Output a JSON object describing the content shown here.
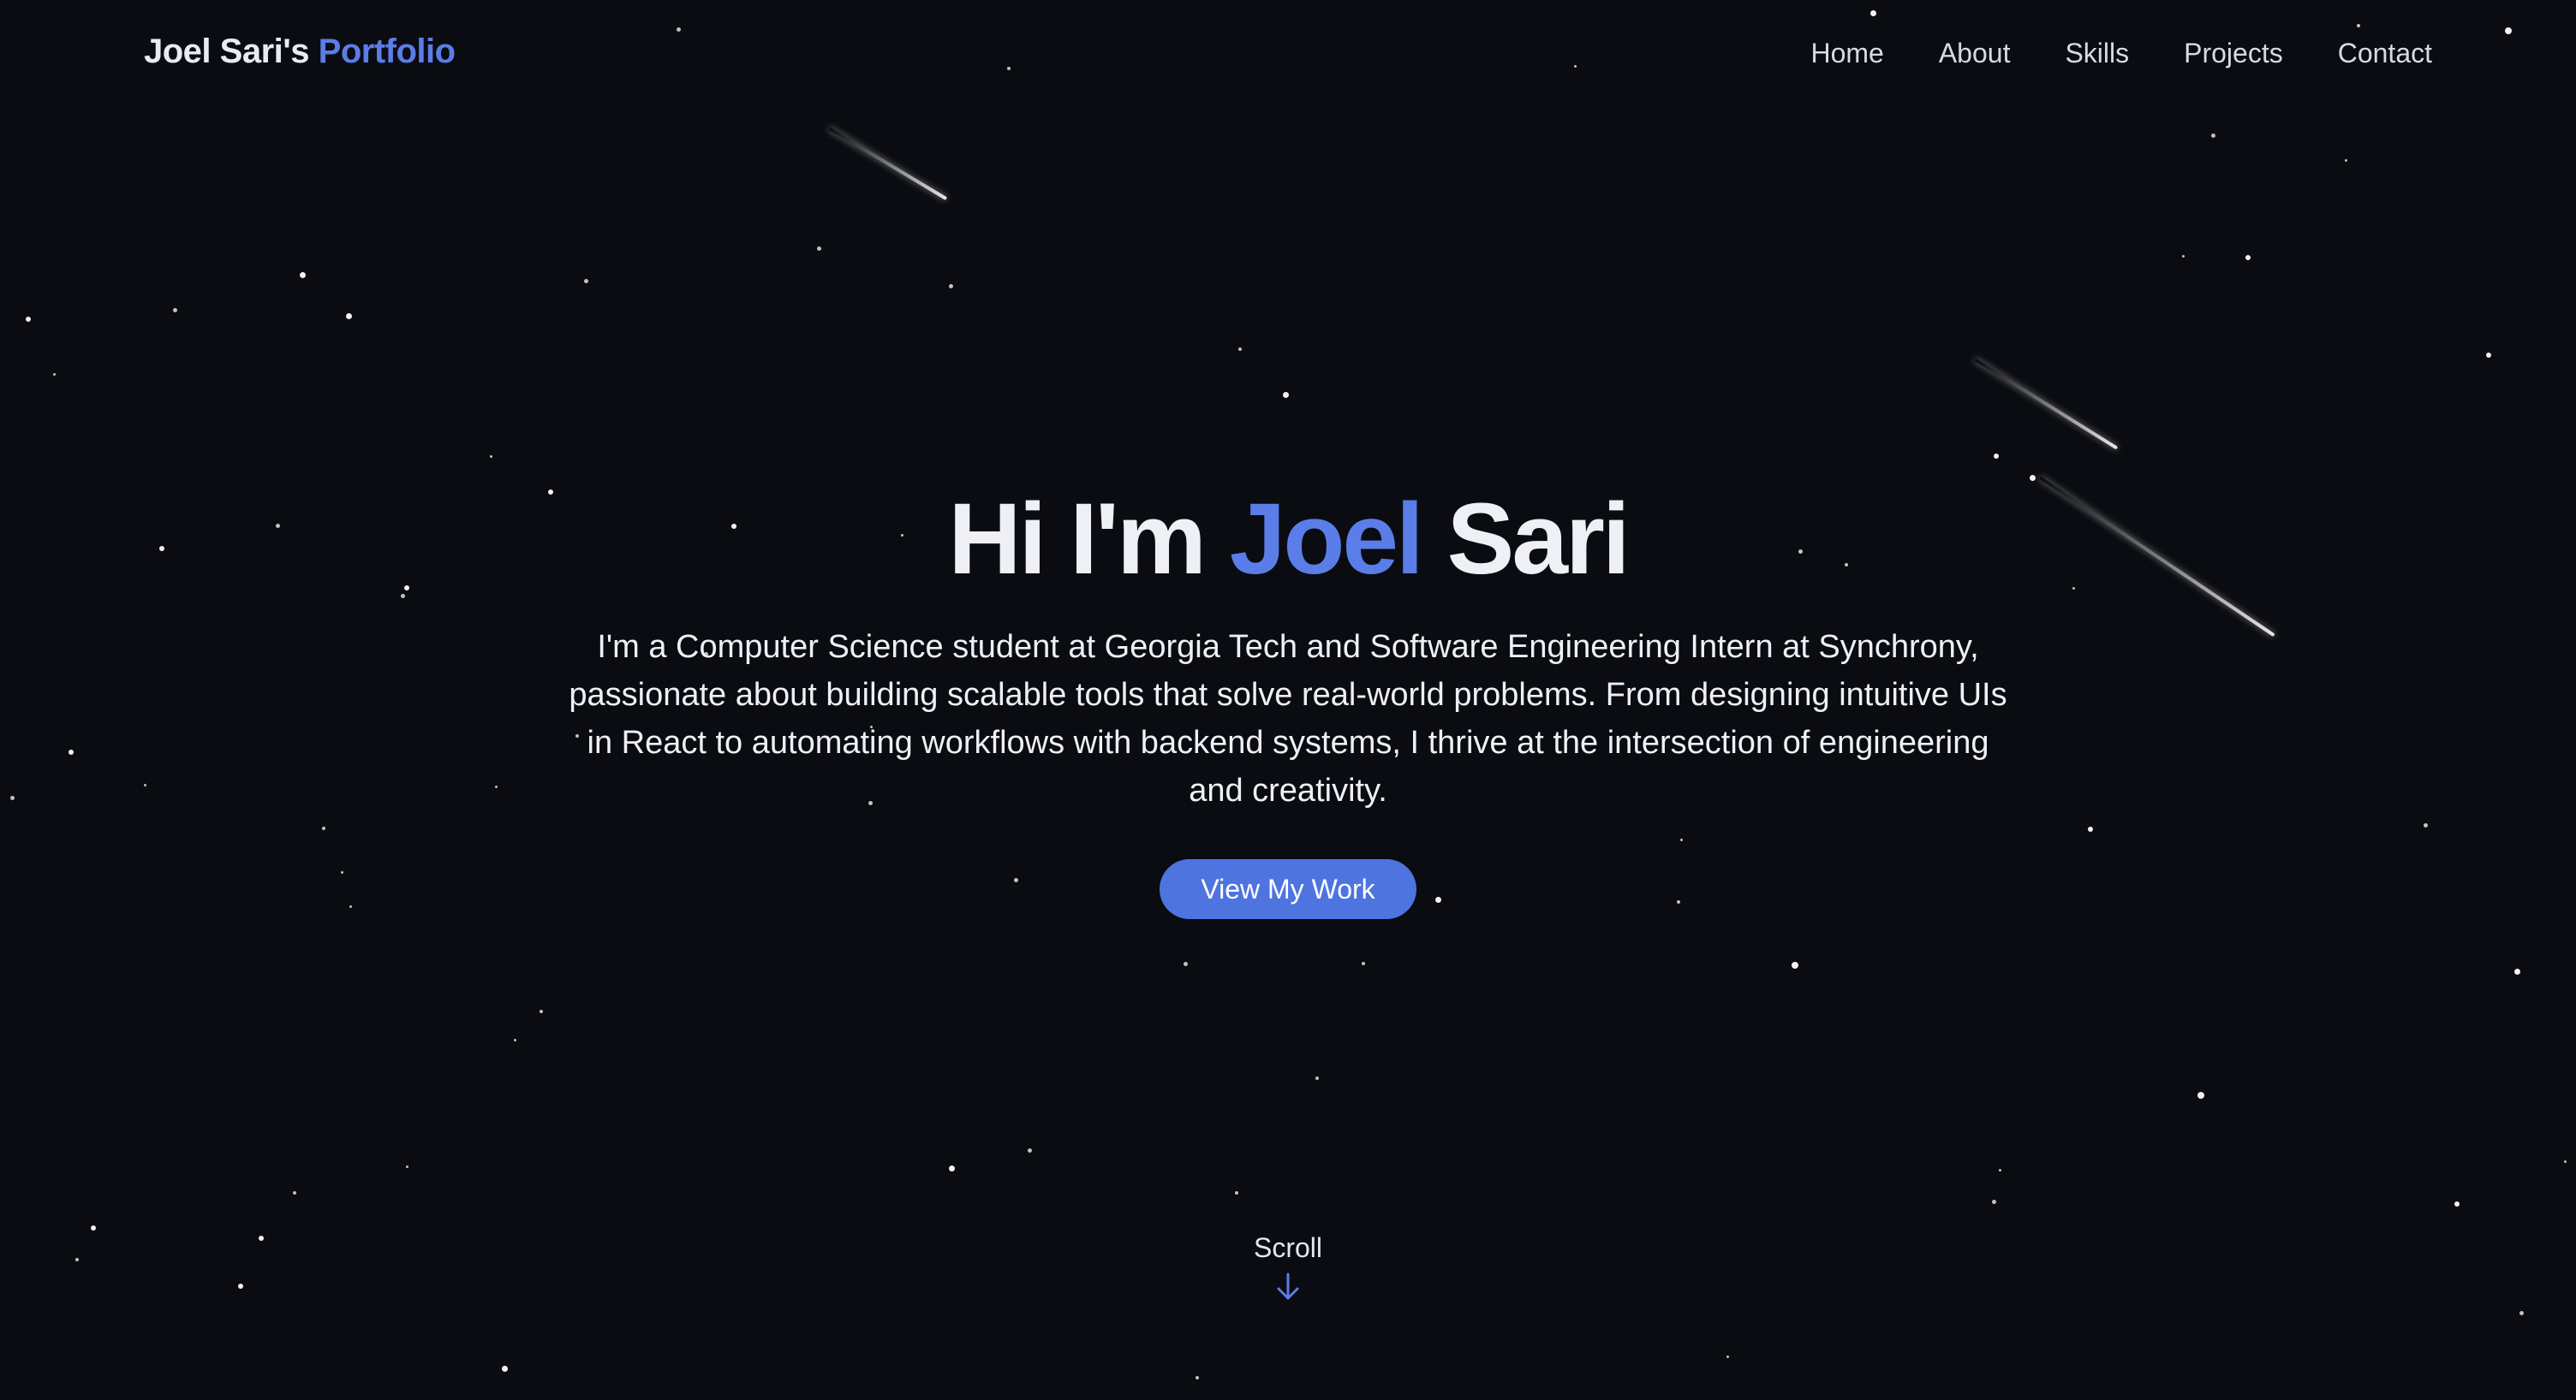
{
  "logo": {
    "name": "Joel Sari's",
    "accent": "Portfolio"
  },
  "nav": {
    "items": [
      {
        "label": "Home"
      },
      {
        "label": "About"
      },
      {
        "label": "Skills"
      },
      {
        "label": "Projects"
      },
      {
        "label": "Contact"
      }
    ]
  },
  "hero": {
    "greeting": "Hi I'm",
    "first_name": "Joel",
    "last_name": "Sari",
    "description": "I'm a Computer Science student at Georgia Tech and Software Engineering Intern at Synchrony, passionate about building scalable tools that solve real-world problems. From designing intuitive UIs in React to automating workflows with backend systems, I thrive at the intersection of engineering and creativity.",
    "cta_label": "View My Work"
  },
  "scroll": {
    "label": "Scroll",
    "icon": "arrow-down-icon"
  },
  "colors": {
    "background": "#0a0c12",
    "accent": "#5b7de8",
    "button": "#4e74e0",
    "text": "#eef0f5"
  }
}
